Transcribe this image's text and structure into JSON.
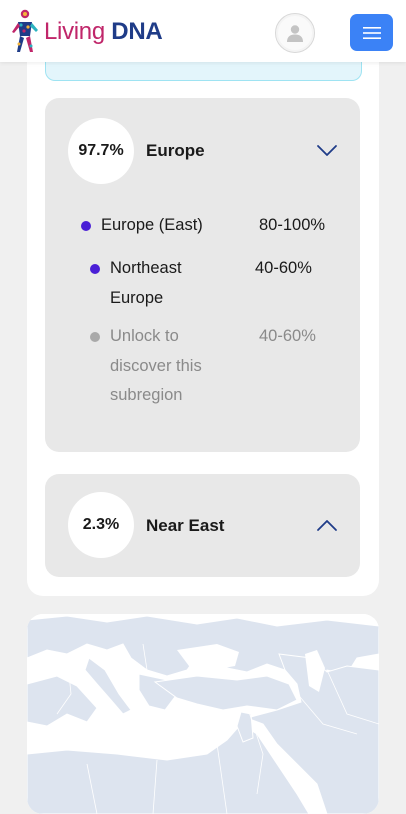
{
  "header": {
    "logo_living": "Living",
    "logo_dna": "DNA",
    "account_icon": "user-icon",
    "menu_icon": "hamburger-menu-icon"
  },
  "colors": {
    "menu_button": "#3b82f6",
    "dot_primary": "#4a1fd6",
    "dot_locked": "#a9a9a9",
    "card_bg": "#e8e8e8"
  },
  "regions": [
    {
      "percentage": "97.7%",
      "name": "Europe",
      "expanded": true,
      "chevron_icon": "chevron-down-icon",
      "subregions": [
        {
          "name": "Europe (East)",
          "range": "80-100%",
          "locked": false
        },
        {
          "name_lines": [
            "Northeast",
            "Europe"
          ],
          "range": "40-60%",
          "locked": false
        },
        {
          "name_lines": [
            "Unlock to",
            "discover this",
            "subregion"
          ],
          "range": "40-60%",
          "locked": true
        }
      ]
    },
    {
      "percentage": "2.3%",
      "name": "Near East",
      "expanded": false,
      "chevron_icon": "chevron-up-icon"
    }
  ],
  "map": {
    "icon": "regional-map"
  }
}
